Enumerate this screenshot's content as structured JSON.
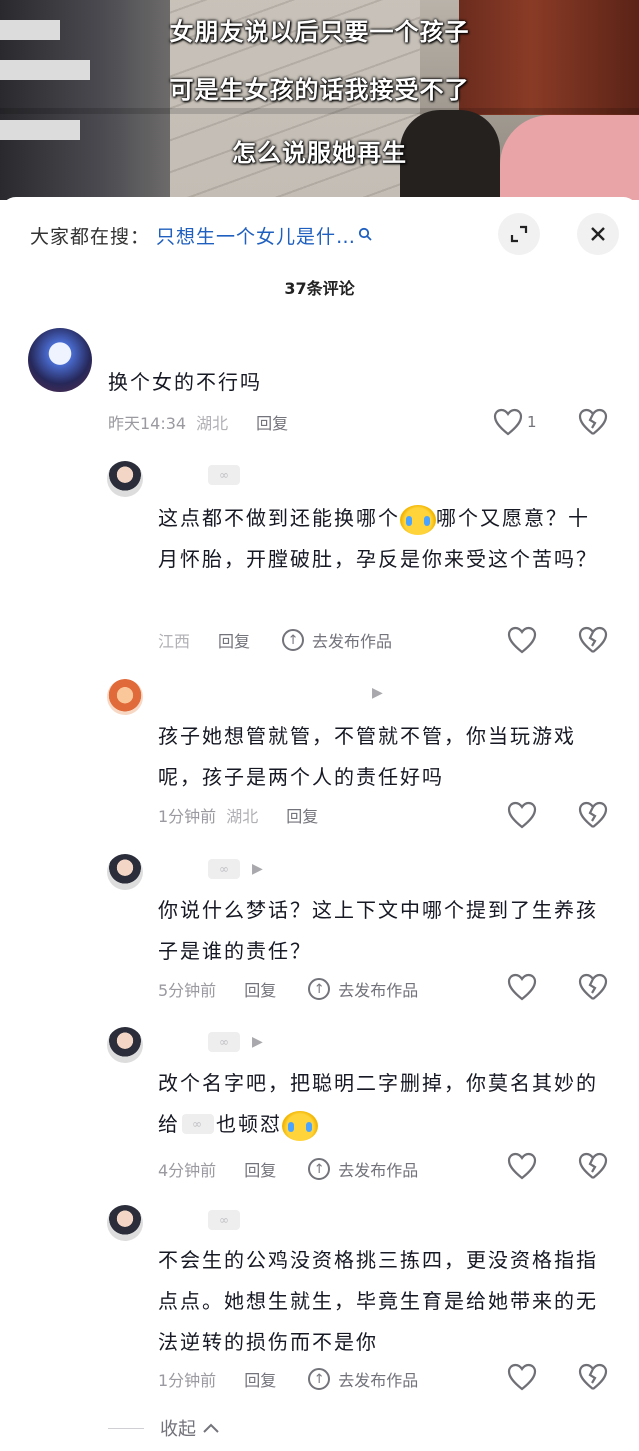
{
  "video": {
    "captions": [
      "女朋友说以后只要一个孩子",
      "可是生女孩的话我接受不了",
      "怎么说服她再生"
    ]
  },
  "search": {
    "prefix": "大家都在搜：",
    "term": "只想生一个女儿是什…",
    "icon": "search-icon"
  },
  "header": {
    "comment_count": "37条评论",
    "expand_icon": "expand-icon",
    "close_icon": "close-icon"
  },
  "comments": [
    {
      "text": "换个女的不行吗",
      "time": "昨天14:34",
      "location": "湖北",
      "reply": "回复",
      "likes": "1"
    },
    {
      "text": "这点都不做到还能换哪个",
      "text_after_emoji": "哪个又愿意？十月怀胎，开膛破肚，孕反是你来受这个苦吗？",
      "location": "江西",
      "reply": "回复",
      "publish": "去发布作品"
    },
    {
      "text": "孩子她想管就管，不管就不管，你当玩游戏呢，孩子是两个人的责任好吗",
      "time": "1分钟前",
      "location": "湖北",
      "reply": "回复"
    },
    {
      "text": "你说什么梦话？这上下文中哪个提到了生养孩子是谁的责任？",
      "time": "5分钟前",
      "reply": "回复",
      "publish": "去发布作品"
    },
    {
      "text": "改个名字吧，把聪明二字删掉，你莫名其妙的给",
      "text_after_chip": "也顿怼",
      "time": "4分钟前",
      "reply": "回复",
      "publish": "去发布作品"
    },
    {
      "text": "不会生的公鸡没资格挑三拣四，更没资格指指点点。她想生就生，毕竟生育是给她带来的无法逆转的损伤而不是你",
      "time": "1分钟前",
      "reply": "回复",
      "publish": "去发布作品"
    }
  ],
  "footer": {
    "collapse": "收起",
    "collapse_icon": "chevron-up-icon"
  }
}
